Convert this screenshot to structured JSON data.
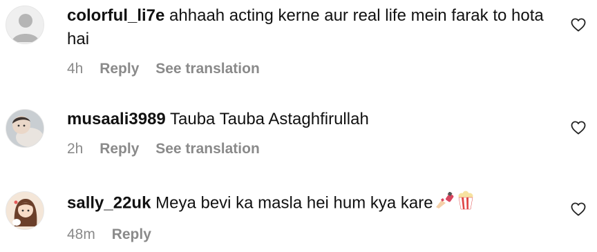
{
  "comments": [
    {
      "username": "colorful_li7e",
      "text": "ahhaah acting kerne aur real life mein farak to hota hai",
      "time": "4h",
      "reply_label": "Reply",
      "translate_label": "See translation",
      "avatar": "default-user-icon"
    },
    {
      "username": "musaali3989",
      "text": "Tauba Tauba Astaghfirullah",
      "time": "2h",
      "reply_label": "Reply",
      "translate_label": "See translation",
      "avatar": "baby-photo"
    },
    {
      "username": "sally_22uk",
      "text": "Meya bevi ka masla hei hum kya kare",
      "time": "48m",
      "reply_label": "Reply",
      "emojis": [
        "nail-polish-emoji",
        "popcorn-emoji"
      ],
      "avatar": "cartoon-girl-photo"
    }
  ],
  "icons": {
    "like": "heart-outline-icon"
  },
  "colors": {
    "secondary_text": "#8a8a8a",
    "primary_text": "#111111"
  }
}
